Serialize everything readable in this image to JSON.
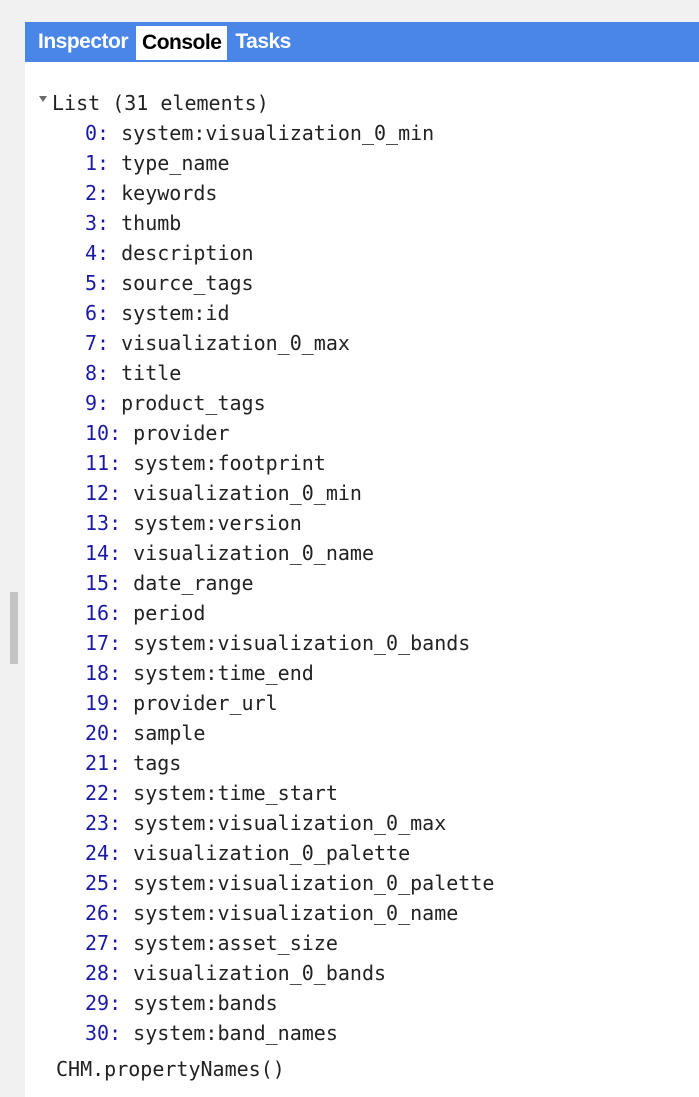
{
  "tabs": [
    {
      "label": "Inspector",
      "active": false
    },
    {
      "label": "Console",
      "active": true
    },
    {
      "label": "Tasks",
      "active": false
    }
  ],
  "console": {
    "list_header": "List (31 elements)",
    "items": [
      {
        "index": "0:",
        "value": "system:visualization_0_min"
      },
      {
        "index": "1:",
        "value": "type_name"
      },
      {
        "index": "2:",
        "value": "keywords"
      },
      {
        "index": "3:",
        "value": "thumb"
      },
      {
        "index": "4:",
        "value": "description"
      },
      {
        "index": "5:",
        "value": "source_tags"
      },
      {
        "index": "6:",
        "value": "system:id"
      },
      {
        "index": "7:",
        "value": "visualization_0_max"
      },
      {
        "index": "8:",
        "value": "title"
      },
      {
        "index": "9:",
        "value": "product_tags"
      },
      {
        "index": "10:",
        "value": "provider"
      },
      {
        "index": "11:",
        "value": "system:footprint"
      },
      {
        "index": "12:",
        "value": "visualization_0_min"
      },
      {
        "index": "13:",
        "value": "system:version"
      },
      {
        "index": "14:",
        "value": "visualization_0_name"
      },
      {
        "index": "15:",
        "value": "date_range"
      },
      {
        "index": "16:",
        "value": "period"
      },
      {
        "index": "17:",
        "value": "system:visualization_0_bands"
      },
      {
        "index": "18:",
        "value": "system:time_end"
      },
      {
        "index": "19:",
        "value": "provider_url"
      },
      {
        "index": "20:",
        "value": "sample"
      },
      {
        "index": "21:",
        "value": "tags"
      },
      {
        "index": "22:",
        "value": "system:time_start"
      },
      {
        "index": "23:",
        "value": "system:visualization_0_max"
      },
      {
        "index": "24:",
        "value": "visualization_0_palette"
      },
      {
        "index": "25:",
        "value": "system:visualization_0_palette"
      },
      {
        "index": "26:",
        "value": "system:visualization_0_name"
      },
      {
        "index": "27:",
        "value": "system:asset_size"
      },
      {
        "index": "28:",
        "value": "visualization_0_bands"
      },
      {
        "index": "29:",
        "value": "system:bands"
      },
      {
        "index": "30:",
        "value": "system:band_names"
      }
    ],
    "command": "CHM.propertyNames()"
  },
  "colors": {
    "tabbar": "#4a86e8",
    "index": "#1a1aa6",
    "text": "#222222"
  },
  "icons": {
    "expand": "triangle-down-icon",
    "resize": "resize-handle-icon"
  }
}
